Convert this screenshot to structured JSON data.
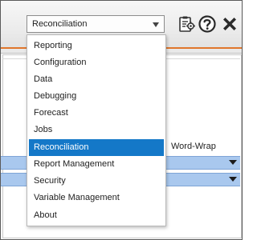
{
  "toolbar": {
    "selected_view": "Reconciliation",
    "icons": [
      "clipboard-gear-icon",
      "help-icon",
      "close-icon"
    ]
  },
  "table": {
    "column_header_word_wrap": "Word-Wrap"
  },
  "dropdown": {
    "items": [
      {
        "label": "Reporting"
      },
      {
        "label": "Configuration"
      },
      {
        "label": "Data"
      },
      {
        "label": "Debugging"
      },
      {
        "label": "Forecast"
      },
      {
        "label": "Jobs"
      },
      {
        "label": "Reconciliation",
        "selected": true
      },
      {
        "label": "Report Management"
      },
      {
        "label": "Security"
      },
      {
        "label": "Variable Management"
      },
      {
        "label": "About"
      }
    ]
  },
  "colors": {
    "accent_orange": "#e0762b",
    "selection_blue": "#1478c8",
    "row_blue": "#a9c8ee"
  }
}
